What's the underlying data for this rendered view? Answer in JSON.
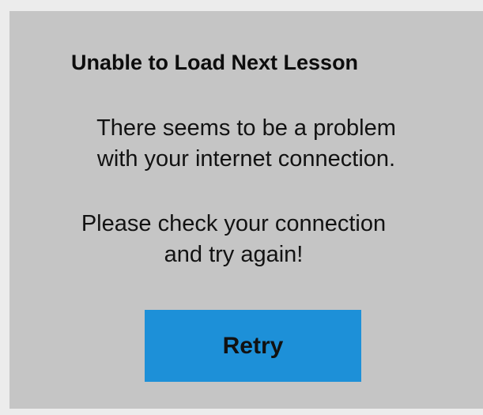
{
  "dialog": {
    "title": "Unable to Load Next Lesson",
    "message_1": {
      "line_1": "There seems to be a problem",
      "line_2": "with your internet connection."
    },
    "message_2": {
      "line_1": "Please check your connection",
      "line_2": "and try again!"
    },
    "retry_label": "Retry"
  },
  "colors": {
    "page_background": "#ececec",
    "dialog_background": "#c5c5c5",
    "button_background": "#1d90d8",
    "text": "#111111"
  }
}
